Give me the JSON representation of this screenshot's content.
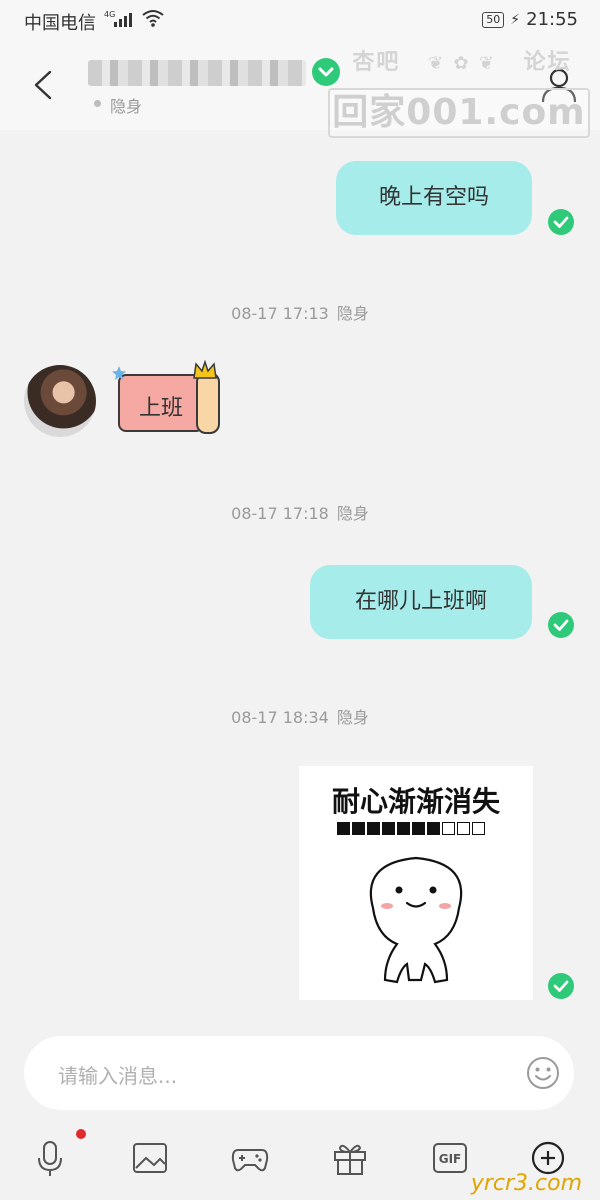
{
  "status_bar": {
    "carrier": "中国电信",
    "network": "4G",
    "battery": "50",
    "time": "21:55"
  },
  "header": {
    "status_text": "隐身"
  },
  "watermark_top": {
    "left": "杏吧",
    "right": "论坛",
    "box": "回家001.com"
  },
  "messages": [
    {
      "side": "right",
      "type": "text",
      "text": "晚上有空吗"
    },
    {
      "type": "timestamp",
      "time": "08-17 17:13",
      "status": "隐身"
    },
    {
      "side": "left",
      "type": "sticker",
      "text": "上班"
    },
    {
      "type": "timestamp",
      "time": "08-17 17:18",
      "status": "隐身"
    },
    {
      "side": "right",
      "type": "text",
      "text": "在哪儿上班啊"
    },
    {
      "type": "timestamp",
      "time": "08-17 18:34",
      "status": "隐身"
    },
    {
      "side": "right",
      "type": "image",
      "caption": "耐心渐渐消失",
      "progress": 0.7
    }
  ],
  "input": {
    "placeholder": "请输入消息..."
  },
  "toolbar": {
    "items": [
      "microphone-icon",
      "image-icon",
      "game-icon",
      "gift-icon",
      "gif-icon",
      "plus-icon"
    ],
    "gif_label": "GIF"
  },
  "watermark_bottom": "yrcr3.com",
  "colors": {
    "bubble": "#a6ecea",
    "tick": "#2fc97a",
    "background": "#f2f2f2",
    "badge": "#e02b2b"
  }
}
